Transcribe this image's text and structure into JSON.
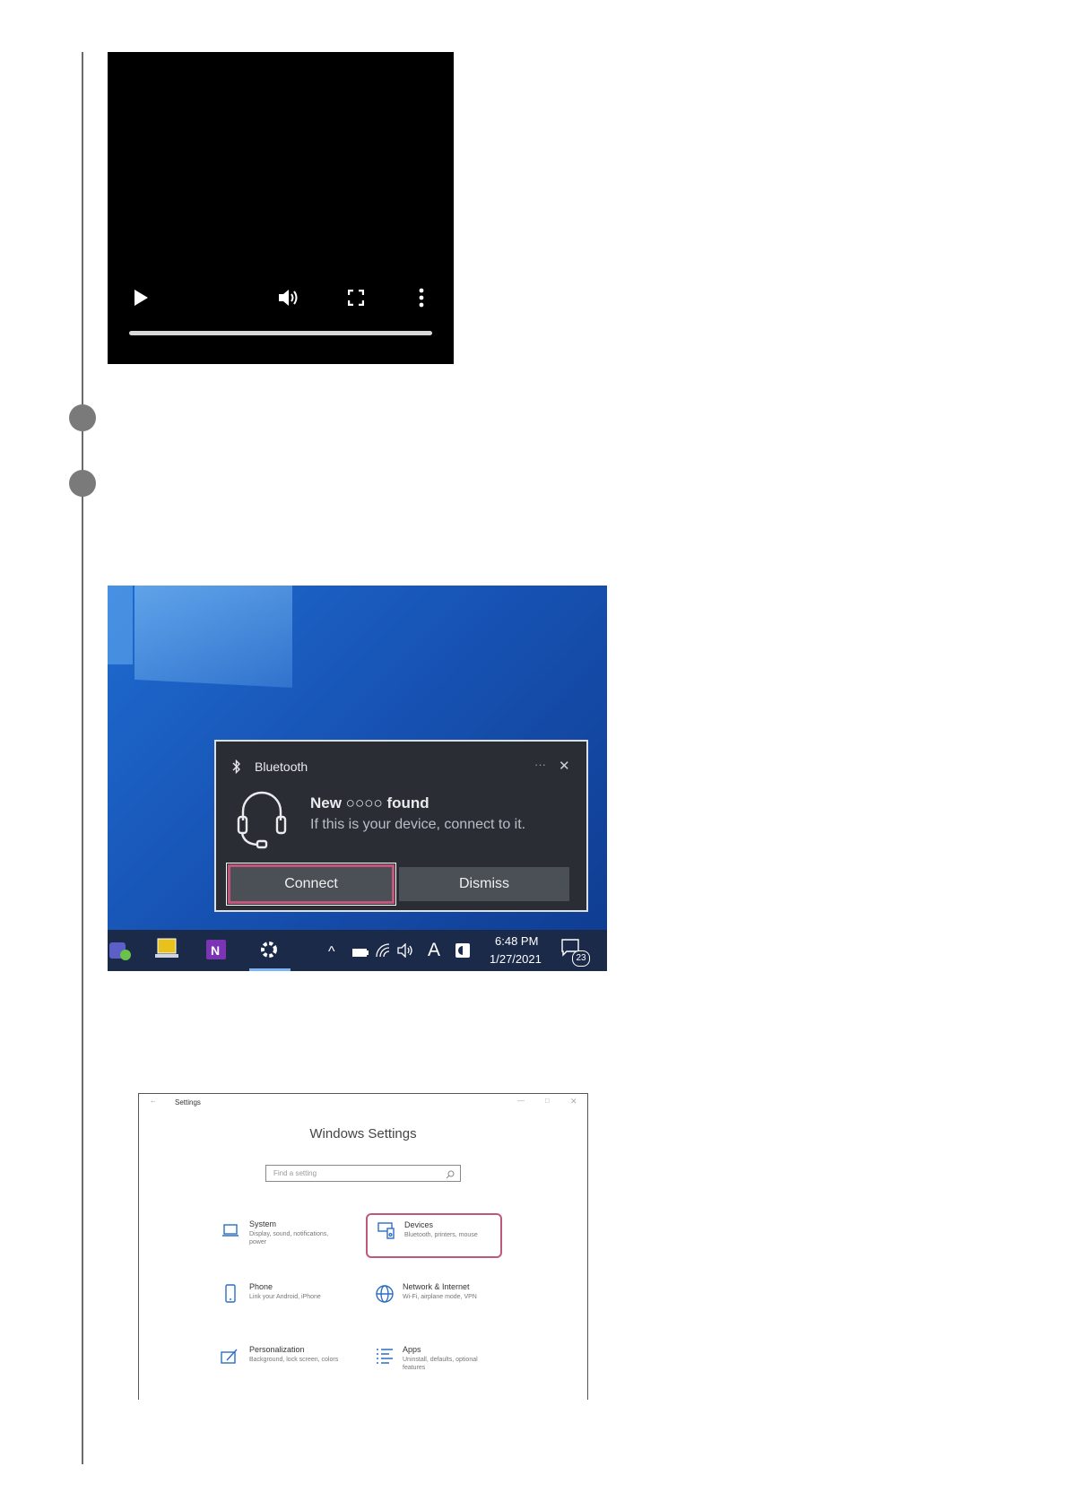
{
  "video": {
    "play_icon": "play-icon",
    "volume_icon": "volume-icon",
    "fullscreen_icon": "fullscreen-icon",
    "more_icon": "more-vertical-icon"
  },
  "notification": {
    "app": "Bluetooth",
    "title": "New ○○○○ found",
    "message": "If this is your device, connect to it.",
    "connect_label": "Connect",
    "dismiss_label": "Dismiss",
    "more_label": "···",
    "close_label": "✕"
  },
  "taskbar": {
    "time": "6:48 PM",
    "date": "1/27/2021",
    "lang": "A",
    "notification_count": "23",
    "chevron": "^"
  },
  "settings": {
    "window_title": "Settings",
    "heading": "Windows Settings",
    "search_placeholder": "Find a setting",
    "tiles": [
      {
        "name": "System",
        "desc": "Display, sound, notifications, power"
      },
      {
        "name": "Devices",
        "desc": "Bluetooth, printers, mouse"
      },
      {
        "name": "Phone",
        "desc": "Link your Android, iPhone"
      },
      {
        "name": "Network & Internet",
        "desc": "Wi-Fi, airplane mode, VPN"
      },
      {
        "name": "Personalization",
        "desc": "Background, lock screen, colors"
      },
      {
        "name": "Apps",
        "desc": "Uninstall, defaults, optional features"
      }
    ]
  },
  "colors": {
    "highlight": "#c2577e",
    "desktop_blue": "#1753b4",
    "taskbar": "#1c2a49",
    "settings_icon_blue": "#2b6fc4"
  }
}
